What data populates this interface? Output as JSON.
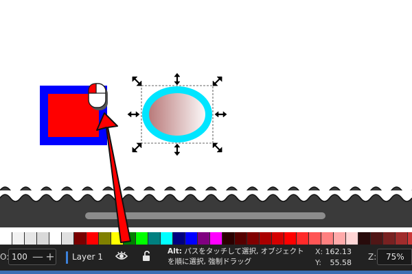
{
  "canvas": {
    "rect_fill": "#ff0000",
    "rect_stroke": "#0000ff",
    "ellipse_stroke": "#00e5ff",
    "ellipse_gradient_start": "#b57373",
    "ellipse_gradient_end": "#ffffff"
  },
  "palette": {
    "swatches": [
      "#ffffff",
      "#f2f2f2",
      "#e6e6e6",
      "#d9d9d9",
      "#ffffff",
      "#e0e0e0",
      "#7a0000",
      "#ff0000",
      "#808000",
      "#ffff00",
      "#008000",
      "#00ff00",
      "#008080",
      "#00ffff",
      "#000080",
      "#0000ff",
      "#800080",
      "#ff00ff",
      "#2b0000",
      "#550000",
      "#800000",
      "#aa0000",
      "#d40000",
      "#ff0000",
      "#ff2a2a",
      "#ff5555",
      "#ff8080",
      "#ffaaaa",
      "#ffd5d5",
      "#280b0b",
      "#501616",
      "#782121",
      "#a02c2c",
      "#c83737",
      "#d35f5f",
      "#de8787"
    ]
  },
  "status": {
    "opacity_label": "O:",
    "opacity_value": "100",
    "minus_label": "—",
    "plus_label": "+",
    "layer_name": "Layer 1",
    "hint_key": "Alt:",
    "hint_text": " パスをタッチして選択, オブジェクトを順に選択, 強制ドラッグ",
    "x_label": "X:",
    "x_value": "162.13",
    "y_label": "Y:",
    "y_value": "55.58",
    "zoom_label": "Z:",
    "zoom_value": "75%"
  },
  "icons": {
    "eye": "eye-icon",
    "lock": "lock-open-icon",
    "mouse": "mouse-left-click-icon",
    "arrow": "red-arrow-annotation"
  }
}
